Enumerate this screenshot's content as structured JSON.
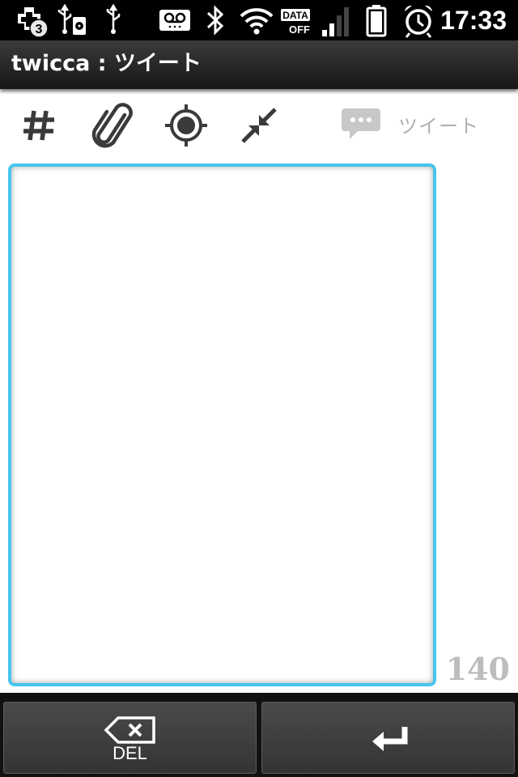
{
  "status_bar": {
    "notification_count": "3",
    "data_label_top": "DATA",
    "data_label_bottom": "OFF",
    "time": "17:33"
  },
  "title_bar": {
    "title": "twicca : ツイート"
  },
  "toolbar": {
    "icons": [
      "hashtag-icon",
      "paperclip-icon",
      "location-icon",
      "shrink-icon"
    ],
    "tweet_label": "ツイート"
  },
  "editor": {
    "text": "",
    "remaining_chars": "140",
    "accent_color": "#47c5ee"
  },
  "keyboard": {
    "del_label": "DEL"
  }
}
